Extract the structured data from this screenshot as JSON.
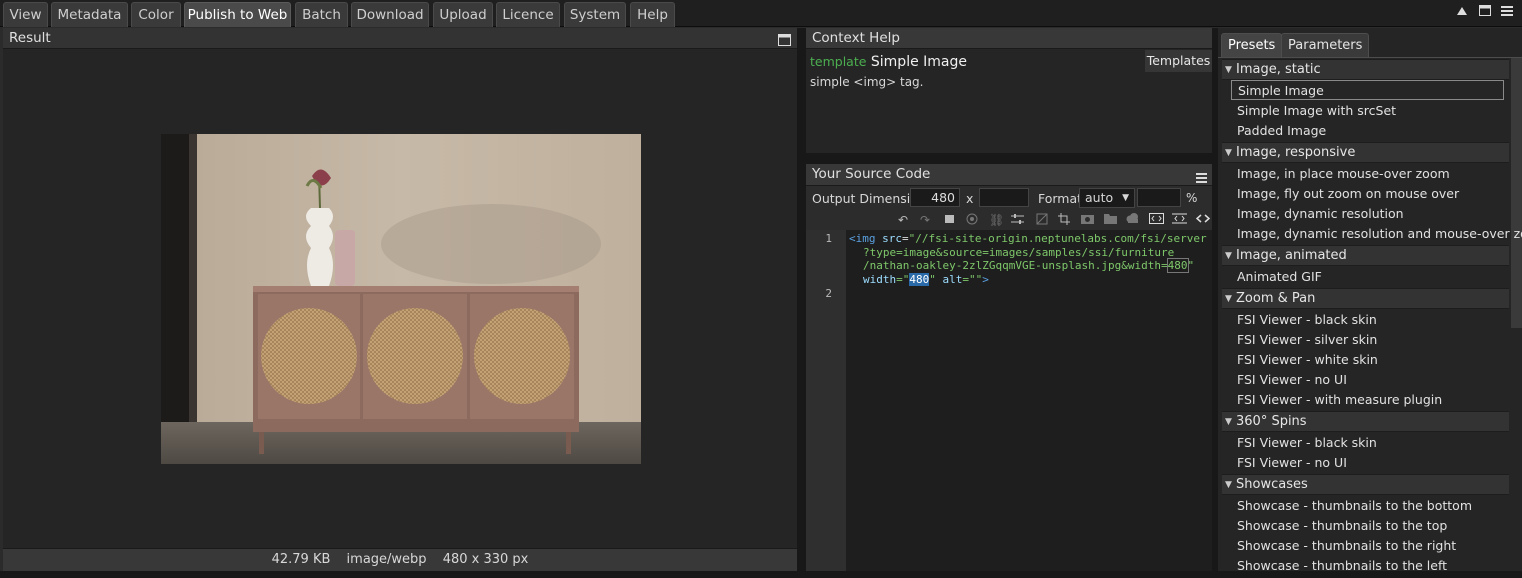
{
  "tabs": [
    "View",
    "Metadata",
    "Color",
    "Publish to Web",
    "Batch",
    "Download",
    "Upload",
    "Licence",
    "System",
    "Help"
  ],
  "result": {
    "title": "Result",
    "status": {
      "size": "42.79 KB",
      "mime": "image/webp",
      "dims": "480 x 330 px"
    }
  },
  "context": {
    "title": "Context Help",
    "kind": "template",
    "name": "Simple Image",
    "desc": "simple <img> tag.",
    "templates_btn": "Templates"
  },
  "source": {
    "title": "Your Source Code",
    "output_label": "Output Dimension",
    "width": "480",
    "height": "",
    "x_label": "x",
    "format_label": "Format",
    "format": "auto",
    "quality": "",
    "pct": "%",
    "lines": [
      {
        "num": "1",
        "parts": {
          "p1": "<img ",
          "p2": "src",
          "p3": "=",
          "p4": "\"//fsi-site-origin.neptunelabs.com/fsi/server",
          "p5": "?type=image&source=images/samples/ssi/furniture",
          "p6": "/nathan-oakley-2zlZGqqmVGE-unsplash.jpg&width=",
          "p7": "480",
          "p8": "\"",
          "p9": "width",
          "p10": "=\"",
          "p11": "480",
          "p12": "\" ",
          "p13": "alt",
          "p14": "=\"\"",
          "p15": ">"
        }
      },
      {
        "num": "2"
      }
    ]
  },
  "right": {
    "tabs": [
      "Presets",
      "Parameters"
    ],
    "groups": [
      {
        "name": "Image, static",
        "items": [
          "Simple Image",
          "Simple Image with srcSet",
          "Padded Image"
        ]
      },
      {
        "name": "Image, responsive",
        "items": [
          "Image, in place mouse-over zoom",
          "Image, fly out zoom on mouse over",
          "Image, dynamic resolution",
          "Image, dynamic resolution and mouse-over zoom"
        ]
      },
      {
        "name": "Image, animated",
        "items": [
          "Animated GIF"
        ]
      },
      {
        "name": "Zoom & Pan",
        "items": [
          "FSI Viewer - black skin",
          "FSI Viewer - silver skin",
          "FSI Viewer - white skin",
          "FSI Viewer - no UI",
          "FSI Viewer - with measure plugin"
        ]
      },
      {
        "name": "360° Spins",
        "items": [
          "FSI Viewer - black skin",
          "FSI Viewer - no UI"
        ]
      },
      {
        "name": "Showcases",
        "items": [
          "Showcase - thumbnails to the bottom",
          "Showcase - thumbnails to the top",
          "Showcase - thumbnails to the right",
          "Showcase - thumbnails to the left"
        ]
      }
    ]
  },
  "colors": {
    "accent_green": "#4caf50",
    "code_tag": "#5aa0e0",
    "code_attr": "#d8d8d8",
    "code_string": "#7ec86a"
  },
  "icons": [
    "triangle-up-icon",
    "maximize-icon",
    "menu-icon",
    "undo-icon",
    "redo-icon",
    "copy-icon",
    "eye-icon",
    "link-icon",
    "sliders-icon",
    "no-crop-icon",
    "crop-icon",
    "camera-icon",
    "folder-icon",
    "cloud-icon",
    "code-box-icon",
    "code-wrap-icon",
    "code-icon"
  ]
}
